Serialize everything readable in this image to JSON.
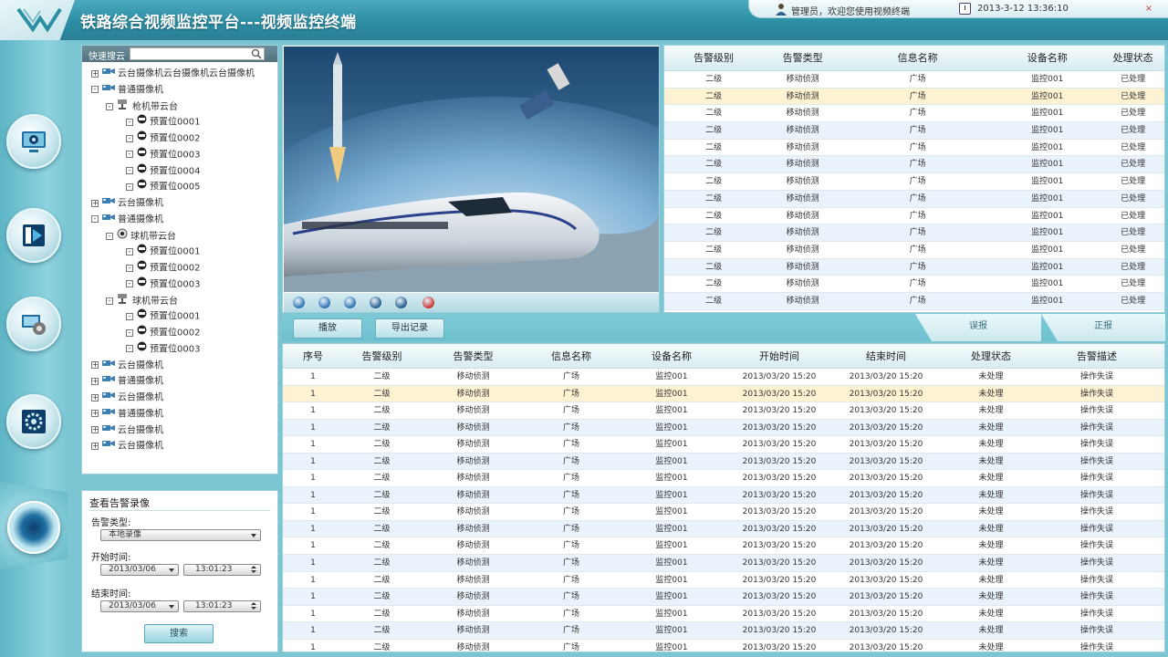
{
  "header": {
    "title": "铁路综合视频监控平台---视频监控终端",
    "user_text": "管理员，欢迎您使用视频终端",
    "datetime": "2013-3-12  13:36:10",
    "close_label": "×"
  },
  "rail": {
    "items": [
      "monitor-icon",
      "playback-icon",
      "config-icon",
      "settings-icon",
      "alarm-eye-icon"
    ]
  },
  "quick_search": {
    "label": "快速搜云",
    "placeholder": ""
  },
  "tree": [
    {
      "level": 0,
      "toggle": "+",
      "icon": "camera-icon",
      "label": "云台摄像机云台摄像机云台摄像机"
    },
    {
      "level": 0,
      "toggle": "-",
      "icon": "camera-icon",
      "label": "普通摄像机"
    },
    {
      "level": 1,
      "toggle": "-",
      "icon": "ptz-icon",
      "label": "枪机带云台"
    },
    {
      "level": 2,
      "toggle": "-",
      "icon": "preset-icon",
      "label": "预置位0001"
    },
    {
      "level": 2,
      "toggle": "-",
      "icon": "preset-icon",
      "label": "预置位0002"
    },
    {
      "level": 2,
      "toggle": "-",
      "icon": "preset-icon",
      "label": "预置位0003"
    },
    {
      "level": 2,
      "toggle": "-",
      "icon": "preset-icon",
      "label": "预置位0004"
    },
    {
      "level": 2,
      "toggle": "-",
      "icon": "preset-icon",
      "label": "预置位0005"
    },
    {
      "level": 0,
      "toggle": "+",
      "icon": "camera-icon",
      "label": "云台摄像机"
    },
    {
      "level": 0,
      "toggle": "-",
      "icon": "camera-icon",
      "label": "普通摄像机"
    },
    {
      "level": 1,
      "toggle": "-",
      "icon": "dome-icon",
      "label": "球机带云台"
    },
    {
      "level": 2,
      "toggle": "-",
      "icon": "preset-icon",
      "label": "预置位0001"
    },
    {
      "level": 2,
      "toggle": "-",
      "icon": "preset-icon",
      "label": "预置位0002"
    },
    {
      "level": 2,
      "toggle": "-",
      "icon": "preset-icon",
      "label": "预置位0003"
    },
    {
      "level": 1,
      "toggle": "-",
      "icon": "ptz-icon",
      "label": "球机带云台"
    },
    {
      "level": 2,
      "toggle": "-",
      "icon": "preset-icon",
      "label": "预置位0001"
    },
    {
      "level": 2,
      "toggle": "-",
      "icon": "preset-icon",
      "label": "预置位0002"
    },
    {
      "level": 2,
      "toggle": "-",
      "icon": "preset-icon",
      "label": "预置位0003"
    },
    {
      "level": 0,
      "toggle": "+",
      "icon": "camera-icon",
      "label": "云台摄像机"
    },
    {
      "level": 0,
      "toggle": "+",
      "icon": "camera-icon",
      "label": "普通摄像机"
    },
    {
      "level": 0,
      "toggle": "+",
      "icon": "camera-icon",
      "label": "云台摄像机"
    },
    {
      "level": 0,
      "toggle": "+",
      "icon": "camera-icon",
      "label": "普通摄像机"
    },
    {
      "level": 0,
      "toggle": "+",
      "icon": "camera-icon",
      "label": "云台摄像机"
    },
    {
      "level": 0,
      "toggle": "+",
      "icon": "camera-icon",
      "label": "云台摄像机"
    }
  ],
  "alarm_query": {
    "title": "查看告警录像",
    "type_label": "告警类型:",
    "type_value": "本地录像",
    "start_label": "开始时间:",
    "start_date": "2013/03/06",
    "start_time": "13:01:23",
    "end_label": "结束时间:",
    "end_date": "2013/03/06",
    "end_time": "13:01:23",
    "search_label": "搜索"
  },
  "video_controls": [
    "rewind-icon",
    "pause-icon",
    "forward-icon",
    "snapshot-icon",
    "audio-icon",
    "stop-icon"
  ],
  "top_table": {
    "headers": [
      "告警级别",
      "告警类型",
      "信息名称",
      "设备名称",
      "处理状态"
    ],
    "selected_row": 1,
    "rows": [
      [
        "二级",
        "移动侦测",
        "广场",
        "监控001",
        "已处理"
      ],
      [
        "二级",
        "移动侦测",
        "广场",
        "监控001",
        "已处理"
      ],
      [
        "二级",
        "移动侦测",
        "广场",
        "监控001",
        "已处理"
      ],
      [
        "二级",
        "移动侦测",
        "广场",
        "监控001",
        "已处理"
      ],
      [
        "二级",
        "移动侦测",
        "广场",
        "监控001",
        "已处理"
      ],
      [
        "二级",
        "移动侦测",
        "广场",
        "监控001",
        "已处理"
      ],
      [
        "二级",
        "移动侦测",
        "广场",
        "监控001",
        "已处理"
      ],
      [
        "二级",
        "移动侦测",
        "广场",
        "监控001",
        "已处理"
      ],
      [
        "二级",
        "移动侦测",
        "广场",
        "监控001",
        "已处理"
      ],
      [
        "二级",
        "移动侦测",
        "广场",
        "监控001",
        "已处理"
      ],
      [
        "二级",
        "移动侦测",
        "广场",
        "监控001",
        "已处理"
      ],
      [
        "二级",
        "移动侦测",
        "广场",
        "监控001",
        "已处理"
      ],
      [
        "二级",
        "移动侦测",
        "广场",
        "监控001",
        "已处理"
      ],
      [
        "二级",
        "移动侦测",
        "广场",
        "监控001",
        "已处理"
      ]
    ]
  },
  "toolbar": {
    "play_label": "播放",
    "export_label": "导出记录",
    "tab_false_alarm": "误报",
    "tab_true_alarm": "正报"
  },
  "bottom_table": {
    "headers": [
      "序号",
      "告警级别",
      "告警类型",
      "信息名称",
      "设备名称",
      "开始时间",
      "结束时间",
      "处理状态",
      "告警描述"
    ],
    "selected_row": 1,
    "rows": [
      [
        "1",
        "二级",
        "移动侦测",
        "广场",
        "监控001",
        "2013/03/20  15:20",
        "2013/03/20  15:20",
        "未处理",
        "操作失误"
      ],
      [
        "1",
        "二级",
        "移动侦测",
        "广场",
        "监控001",
        "2013/03/20  15:20",
        "2013/03/20  15:20",
        "未处理",
        "操作失误"
      ],
      [
        "1",
        "二级",
        "移动侦测",
        "广场",
        "监控001",
        "2013/03/20  15:20",
        "2013/03/20  15:20",
        "未处理",
        "操作失误"
      ],
      [
        "1",
        "二级",
        "移动侦测",
        "广场",
        "监控001",
        "2013/03/20  15:20",
        "2013/03/20  15:20",
        "未处理",
        "操作失误"
      ],
      [
        "1",
        "二级",
        "移动侦测",
        "广场",
        "监控001",
        "2013/03/20  15:20",
        "2013/03/20  15:20",
        "未处理",
        "操作失误"
      ],
      [
        "1",
        "二级",
        "移动侦测",
        "广场",
        "监控001",
        "2013/03/20  15:20",
        "2013/03/20  15:20",
        "未处理",
        "操作失误"
      ],
      [
        "1",
        "二级",
        "移动侦测",
        "广场",
        "监控001",
        "2013/03/20  15:20",
        "2013/03/20  15:20",
        "未处理",
        "操作失误"
      ],
      [
        "1",
        "二级",
        "移动侦测",
        "广场",
        "监控001",
        "2013/03/20  15:20",
        "2013/03/20  15:20",
        "未处理",
        "操作失误"
      ],
      [
        "1",
        "二级",
        "移动侦测",
        "广场",
        "监控001",
        "2013/03/20  15:20",
        "2013/03/20  15:20",
        "未处理",
        "操作失误"
      ],
      [
        "1",
        "二级",
        "移动侦测",
        "广场",
        "监控001",
        "2013/03/20  15:20",
        "2013/03/20  15:20",
        "未处理",
        "操作失误"
      ],
      [
        "1",
        "二级",
        "移动侦测",
        "广场",
        "监控001",
        "2013/03/20  15:20",
        "2013/03/20  15:20",
        "未处理",
        "操作失误"
      ],
      [
        "1",
        "二级",
        "移动侦测",
        "广场",
        "监控001",
        "2013/03/20  15:20",
        "2013/03/20  15:20",
        "未处理",
        "操作失误"
      ],
      [
        "1",
        "二级",
        "移动侦测",
        "广场",
        "监控001",
        "2013/03/20  15:20",
        "2013/03/20  15:20",
        "未处理",
        "操作失误"
      ],
      [
        "1",
        "二级",
        "移动侦测",
        "广场",
        "监控001",
        "2013/03/20  15:20",
        "2013/03/20  15:20",
        "未处理",
        "操作失误"
      ],
      [
        "1",
        "二级",
        "移动侦测",
        "广场",
        "监控001",
        "2013/03/20  15:20",
        "2013/03/20  15:20",
        "未处理",
        "操作失误"
      ],
      [
        "1",
        "二级",
        "移动侦测",
        "广场",
        "监控001",
        "2013/03/20  15:20",
        "2013/03/20  15:20",
        "未处理",
        "操作失误"
      ],
      [
        "1",
        "二级",
        "移动侦测",
        "广场",
        "监控001",
        "2013/03/20  15:20",
        "2013/03/20  15:20",
        "未处理",
        "操作失误"
      ]
    ]
  },
  "colors": {
    "accent": "#2c8ea3",
    "header_bg": "#4ba9bd",
    "row_alt": "#eaf3fb",
    "row_selected": "#fdf2d2"
  }
}
